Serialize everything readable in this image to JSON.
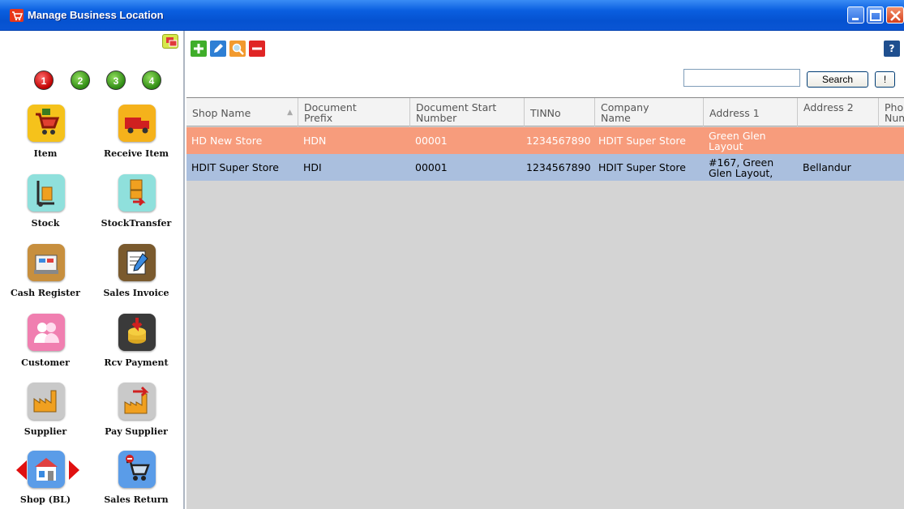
{
  "window": {
    "title": "Manage Business Location",
    "icon": "cart-icon",
    "controls": [
      "minimize-icon",
      "maximize-icon",
      "close-icon"
    ]
  },
  "sidebar": {
    "steps": [
      "1",
      "2",
      "3",
      "4"
    ],
    "items": [
      {
        "label": "Item",
        "icon": "shopping-cart-icon",
        "color": "#f5c21b"
      },
      {
        "label": "Receive Item",
        "icon": "delivery-truck-icon",
        "color": "#f5b21b"
      },
      {
        "label": "Stock",
        "icon": "hand-truck-icon",
        "color": "#8fe0dc"
      },
      {
        "label": "StockTransfer",
        "icon": "boxes-transfer-icon",
        "color": "#8fe0dc"
      },
      {
        "label": "Cash Register",
        "icon": "cash-register-icon",
        "color": "#c78f3e"
      },
      {
        "label": "Sales Invoice",
        "icon": "invoice-pen-icon",
        "color": "#7a5a2e"
      },
      {
        "label": "Customer",
        "icon": "people-icon",
        "color": "#f07fb0"
      },
      {
        "label": "Rcv Payment",
        "icon": "coins-icon",
        "color": "#3a3a3a"
      },
      {
        "label": "Supplier",
        "icon": "factory-icon",
        "color": "#c9c9c9"
      },
      {
        "label": "Pay Supplier",
        "icon": "factory-arrow-icon",
        "color": "#c9c9c9"
      },
      {
        "label": "Shop (BL)",
        "icon": "shop-icon",
        "color": "#5a9ce8"
      },
      {
        "label": "Sales Return",
        "icon": "cart-return-icon",
        "color": "#5a9ce8"
      }
    ]
  },
  "toolbar": {
    "buttons": [
      "add-icon",
      "edit-icon",
      "find-icon",
      "delete-icon"
    ],
    "help": "?",
    "search": {
      "value": "",
      "button": "Search",
      "bang": "!"
    }
  },
  "table": {
    "columns": [
      {
        "label": "Shop Name"
      },
      {
        "label": "Document Prefix"
      },
      {
        "label": "Document Start Number"
      },
      {
        "label": "TINNo"
      },
      {
        "label": "Company Name"
      },
      {
        "label": "Address 1"
      },
      {
        "label": "Address 2"
      },
      {
        "label": "Phone Number"
      }
    ],
    "rows": [
      [
        "HD New Store",
        "HDN",
        "00001",
        "1234567890",
        "HDIT Super Store",
        "Green Glen Layout",
        "",
        ""
      ],
      [
        "HDIT Super Store",
        "HDI",
        "00001",
        "1234567890",
        "HDIT Super Store",
        "#167, Green Glen Layout,",
        "Bellandur",
        ""
      ]
    ]
  }
}
